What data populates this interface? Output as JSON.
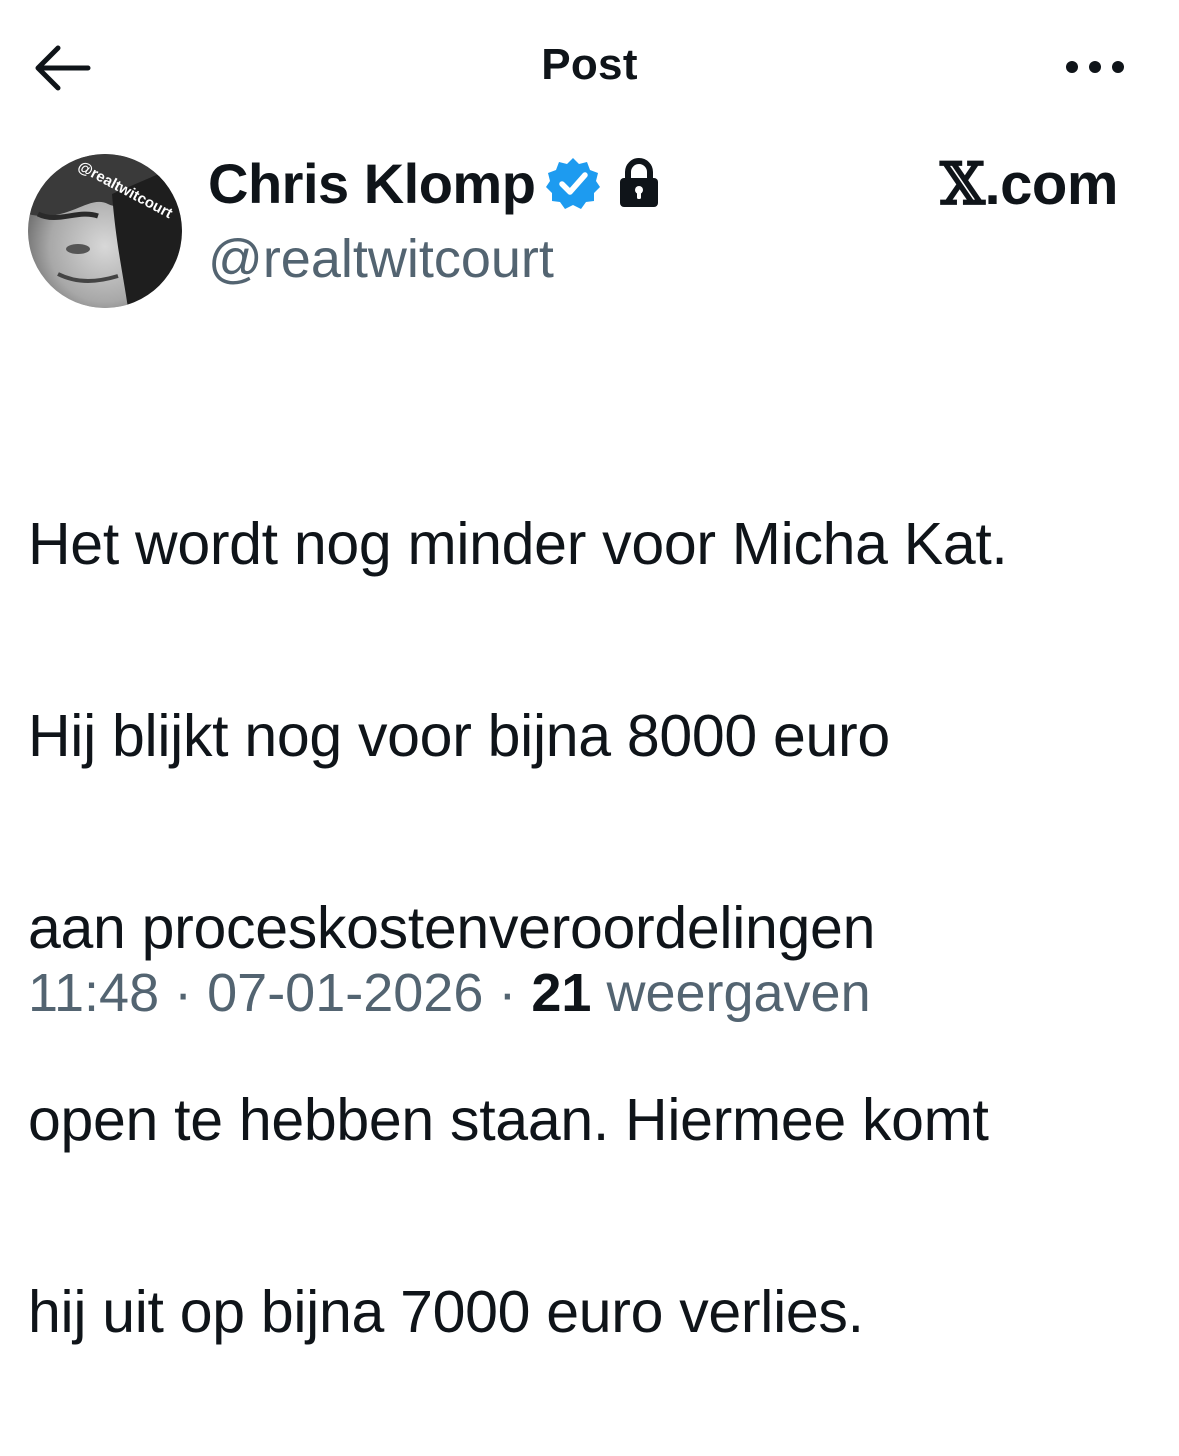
{
  "header": {
    "title": "Post",
    "back_icon": "arrow-left-icon",
    "more_icon": "more-horizontal-icon"
  },
  "author": {
    "display_name": "Chris Klomp",
    "handle": "@realtwitcourt",
    "avatar_text": "@realtwitcourt",
    "verified_icon": "verified-badge-icon",
    "protected_icon": "lock-icon",
    "verified_color": "#1d9bf0"
  },
  "watermark": {
    "x": "𝕏",
    "domain": ".com"
  },
  "post": {
    "lines": [
      "Het wordt nog minder voor Micha Kat.",
      "Hij blijkt nog voor bijna 8000 euro",
      "aan proceskostenveroordelingen",
      "open te hebben staan. Hiermee komt",
      "hij uit op bijna 7000 euro verlies."
    ]
  },
  "meta": {
    "time": "11:48",
    "separator": " · ",
    "date": "07-01-2026",
    "views_count": "21",
    "views_label": " weergaven"
  },
  "colors": {
    "text": "#0f1419",
    "secondary": "#536471",
    "accent": "#1d9bf0"
  }
}
